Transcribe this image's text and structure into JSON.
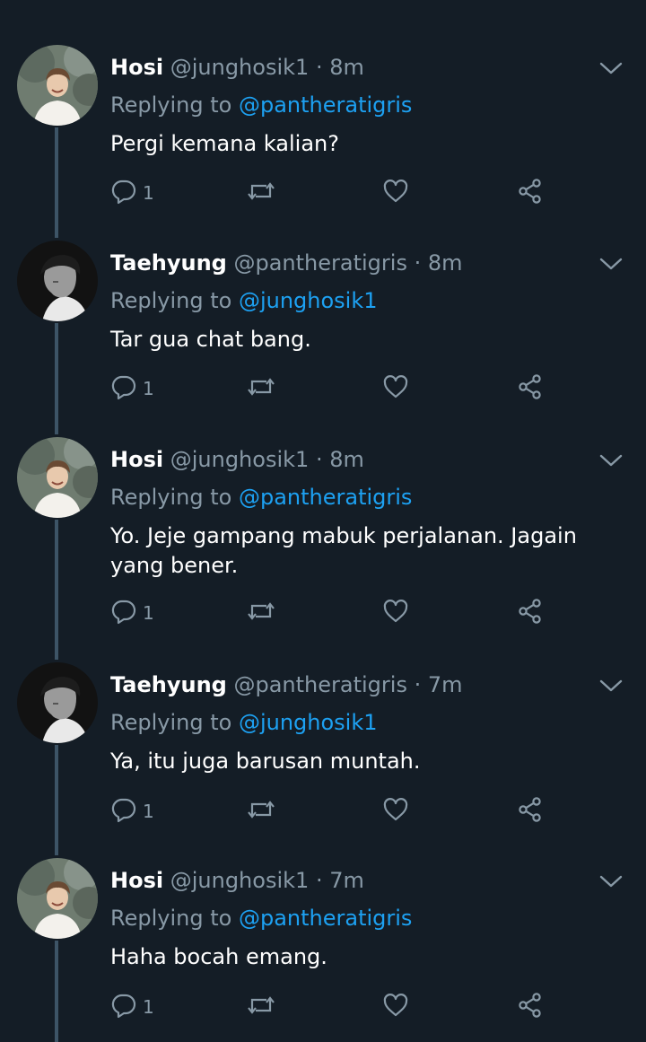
{
  "colors": {
    "background": "#141d26",
    "muted": "#8899a6",
    "link": "#1da1f2",
    "thread_line": "#3d5466"
  },
  "tweets": [
    {
      "name": "Hosi",
      "handle": "@junghosik1",
      "dot": "·",
      "time": "8m",
      "replying_prefix": "Replying to",
      "replying_to": "@pantheratigris",
      "text": "Pergi kemana kalian?",
      "reply_count": "1",
      "avatar": "hosi-avatar"
    },
    {
      "name": "Taehyung",
      "handle": "@pantheratigris",
      "dot": "·",
      "time": "8m",
      "replying_prefix": "Replying to",
      "replying_to": "@junghosik1",
      "text": "Tar gua chat bang.",
      "reply_count": "1",
      "avatar": "taehyung-avatar"
    },
    {
      "name": "Hosi",
      "handle": "@junghosik1",
      "dot": "·",
      "time": "8m",
      "replying_prefix": "Replying to",
      "replying_to": "@pantheratigris",
      "text": "Yo. Jeje gampang mabuk perjalanan. Jagain yang bener.",
      "reply_count": "1",
      "avatar": "hosi-avatar"
    },
    {
      "name": "Taehyung",
      "handle": "@pantheratigris",
      "dot": "·",
      "time": "7m",
      "replying_prefix": "Replying to",
      "replying_to": "@junghosik1",
      "text": "Ya, itu juga barusan muntah.",
      "reply_count": "1",
      "avatar": "taehyung-avatar"
    },
    {
      "name": "Hosi",
      "handle": "@junghosik1",
      "dot": "·",
      "time": "7m",
      "replying_prefix": "Replying to",
      "replying_to": "@pantheratigris",
      "text": "Haha bocah emang.",
      "reply_count": "1",
      "avatar": "hosi-avatar"
    }
  ]
}
